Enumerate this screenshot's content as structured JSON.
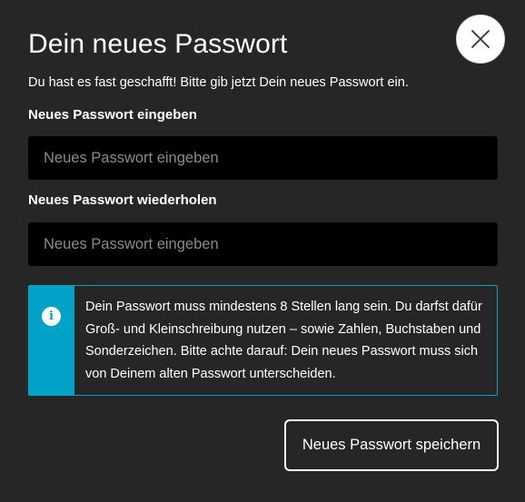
{
  "dialog": {
    "title": "Dein neues Passwort",
    "subtitle": "Du hast es fast geschafft! Bitte gib jetzt Dein neues Passwort ein.",
    "close_icon": "close-icon"
  },
  "form": {
    "new_password": {
      "label": "Neues Passwort eingeben",
      "placeholder": "Neues Passwort eingeben",
      "value": ""
    },
    "repeat_password": {
      "label": "Neues Passwort wiederholen",
      "placeholder": "Neues Passwort eingeben",
      "value": ""
    }
  },
  "info": {
    "icon": "info-icon",
    "icon_glyph": "i",
    "text": "Dein Passwort muss mindestens 8 Stellen lang sein. Du darfst dafür Groß- und Kleinschreibung nutzen – sowie Zahlen, Buchstaben und Sonderzeichen. Bitte achte darauf: Dein neues Passwort muss sich von Deinem alten Passwort unterscheiden."
  },
  "actions": {
    "save_label": "Neues Passwort speichern"
  },
  "colors": {
    "background": "#262626",
    "input_background": "#000000",
    "accent": "#00a3c7",
    "text": "#ffffff"
  }
}
